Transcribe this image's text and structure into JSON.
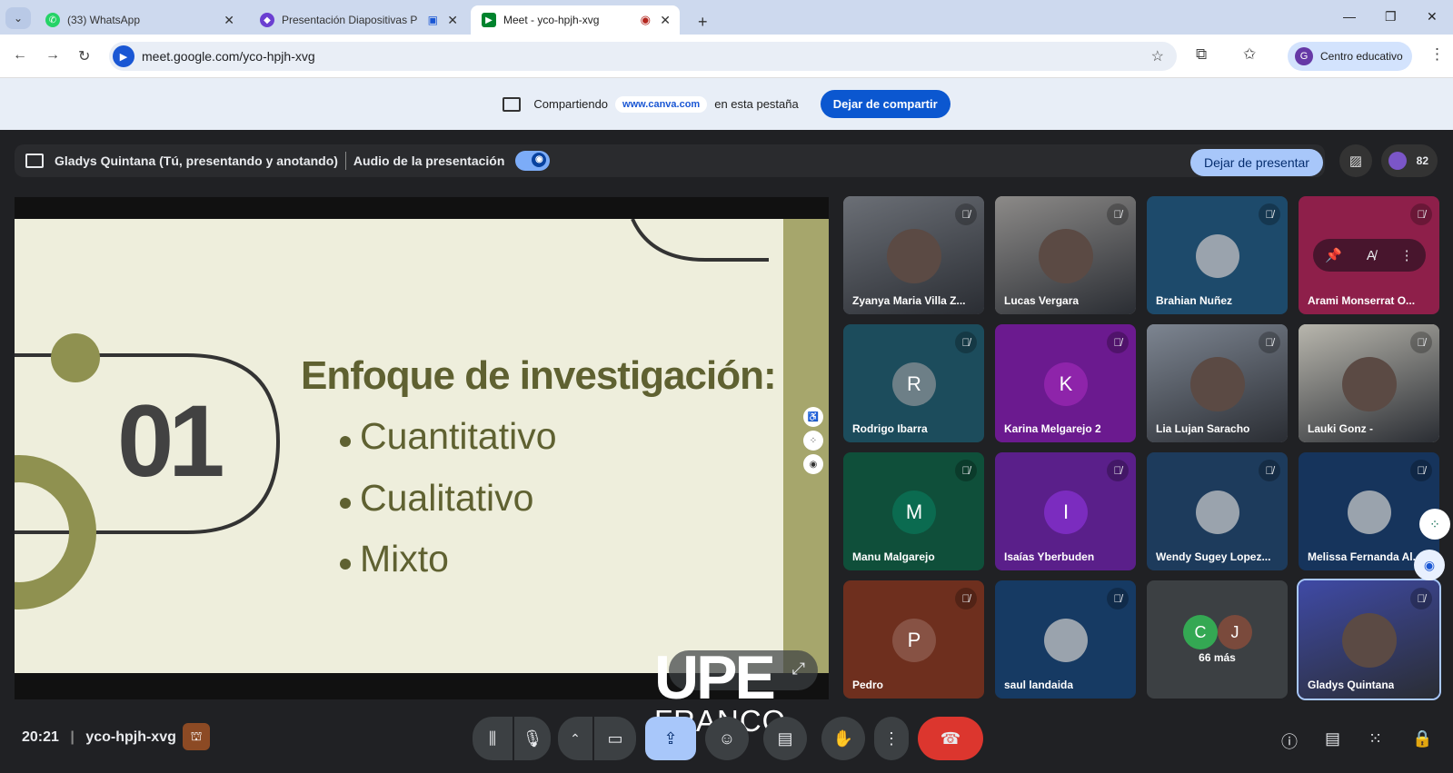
{
  "browser": {
    "tabs": [
      {
        "title": "(33) WhatsApp",
        "icon": "whatsapp-icon",
        "color": "#25d366"
      },
      {
        "title": "Presentación Diapositivas P",
        "icon": "canva-icon",
        "color": "#6b3fd1"
      },
      {
        "title": "Meet - yco-hpjh-xvg",
        "icon": "meet-icon",
        "color": "#00832d"
      }
    ],
    "url": "meet.google.com/yco-hpjh-xvg",
    "profile_name": "Centro educativo",
    "profile_initial": "G"
  },
  "share_bar": {
    "prefix": "Compartiendo",
    "site": "www.canva.com",
    "suffix": "en esta pestaña",
    "stop_label": "Dejar de compartir"
  },
  "presenter_bar": {
    "presenter": "Gladys Quintana (Tú, presentando y anotando)",
    "audio_label": "Audio de la presentación",
    "stop_label": "Dejar de presentar",
    "participant_count": "82"
  },
  "slide": {
    "number": "01",
    "title": "Enfoque de investigación:",
    "bullets": [
      "Cuantitativo",
      "Cualitativo",
      "Mixto"
    ],
    "accent": "#a6a66c"
  },
  "watermark": {
    "line1": "UPE",
    "line2": "FRANCO"
  },
  "participants": [
    {
      "name": "Zyanya Maria Villa Z...",
      "type": "camera",
      "bg": "#6b6f76",
      "initial": ""
    },
    {
      "name": "Lucas Vergara",
      "type": "camera",
      "bg": "#8c8a88",
      "initial": ""
    },
    {
      "name": "Brahian Nuñez",
      "type": "photo",
      "bg": "#1d4a6b",
      "initial": ""
    },
    {
      "name": "Arami Monserrat O...",
      "type": "hover",
      "bg": "#8e1f4a",
      "initial": ""
    },
    {
      "name": "Rodrigo Ibarra",
      "type": "letter",
      "bg": "#1c4c5c",
      "initial": "R",
      "avbg": "#6d7f87"
    },
    {
      "name": "Karina Melgarejo 2",
      "type": "letter",
      "bg": "#6b1a8f",
      "initial": "K",
      "avbg": "#8e24aa"
    },
    {
      "name": "Lia Lujan Saracho",
      "type": "camera",
      "bg": "#7d8591",
      "initial": ""
    },
    {
      "name": "Lauki Gonz -",
      "type": "camera",
      "bg": "#b8b6ad",
      "initial": ""
    },
    {
      "name": "Manu Malgarejo",
      "type": "letter",
      "bg": "#0f4f3a",
      "initial": "M",
      "avbg": "#0b6b50"
    },
    {
      "name": "Isaías Yberbuden",
      "type": "letter",
      "bg": "#5a1f8a",
      "initial": "I",
      "avbg": "#7b2cbf"
    },
    {
      "name": "Wendy Sugey Lopez...",
      "type": "photo",
      "bg": "#1d3b5c",
      "initial": ""
    },
    {
      "name": "Melissa Fernanda Al...",
      "type": "photo",
      "bg": "#16345c",
      "initial": ""
    },
    {
      "name": "Pedro",
      "type": "letter",
      "bg": "#6e2f1e",
      "initial": "P",
      "avbg": "#875244"
    },
    {
      "name": "saul landaida",
      "type": "photo",
      "bg": "#163a63",
      "initial": ""
    },
    {
      "name": "66 más",
      "type": "more",
      "bg": "#3c4043",
      "initial": "",
      "more_initials": [
        "C",
        "J"
      ]
    },
    {
      "name": "Gladys Quintana",
      "type": "camera",
      "bg": "#3f4aa6",
      "initial": ""
    }
  ],
  "meeting": {
    "time": "20:21",
    "code": "yco-hpjh-xvg"
  }
}
